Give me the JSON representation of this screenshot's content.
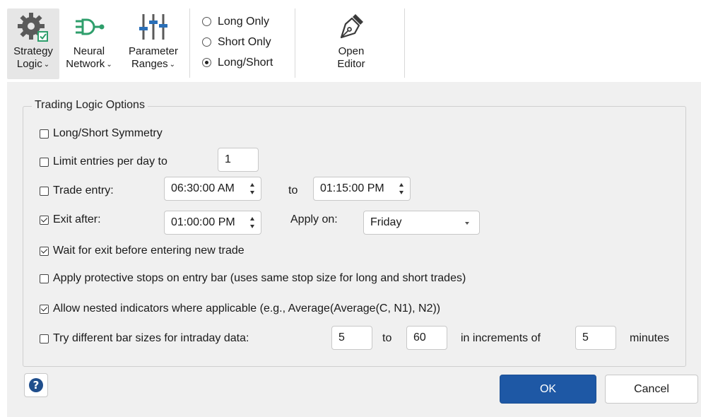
{
  "ribbon": {
    "strategy_logic": {
      "line1": "Strategy",
      "line2": "Logic",
      "icon": "gear-check-icon"
    },
    "neural_network": {
      "line1": "Neural",
      "line2": "Network",
      "icon": "neural-network-icon"
    },
    "parameter_ranges": {
      "line1": "Parameter",
      "line2": "Ranges",
      "icon": "sliders-icon"
    },
    "direction": {
      "options": [
        "Long Only",
        "Short Only",
        "Long/Short"
      ],
      "selected": "Long/Short"
    },
    "open_editor": {
      "line1": "Open",
      "line2": "Editor",
      "icon": "pen-nib-icon"
    }
  },
  "group": {
    "title": "Trading Logic Options"
  },
  "options": {
    "symmetry": {
      "label": "Long/Short Symmetry",
      "checked": false
    },
    "limit_entries": {
      "label": "Limit entries per day to",
      "checked": false,
      "value": "1"
    },
    "trade_entry": {
      "label": "Trade entry:",
      "checked": false,
      "from": "06:30:00 AM",
      "to_label": "to",
      "to": "01:15:00 PM"
    },
    "exit_after": {
      "label": "Exit after:",
      "checked": true,
      "time": "01:00:00 PM",
      "apply_label": "Apply on:",
      "apply_value": "Friday"
    },
    "wait_exit": {
      "label": "Wait for exit before entering new trade",
      "checked": true
    },
    "protective_stops": {
      "label": "Apply protective stops on entry bar (uses same stop size for long and short trades)",
      "checked": false
    },
    "nested": {
      "label": "Allow nested indicators where applicable (e.g., Average(Average(C, N1), N2))",
      "checked": true
    },
    "bar_sizes": {
      "label": "Try different bar sizes for intraday data:",
      "checked": false,
      "from": "5",
      "to_label": "to",
      "to": "60",
      "inc_label": "in increments of",
      "inc": "5",
      "unit": "minutes"
    }
  },
  "buttons": {
    "help": "?",
    "ok": "OK",
    "cancel": "Cancel"
  },
  "colors": {
    "primary": "#1e58a5",
    "help": "#1f4e8c",
    "accent_green": "#2e9e6b",
    "panel": "#f0f0f0"
  }
}
